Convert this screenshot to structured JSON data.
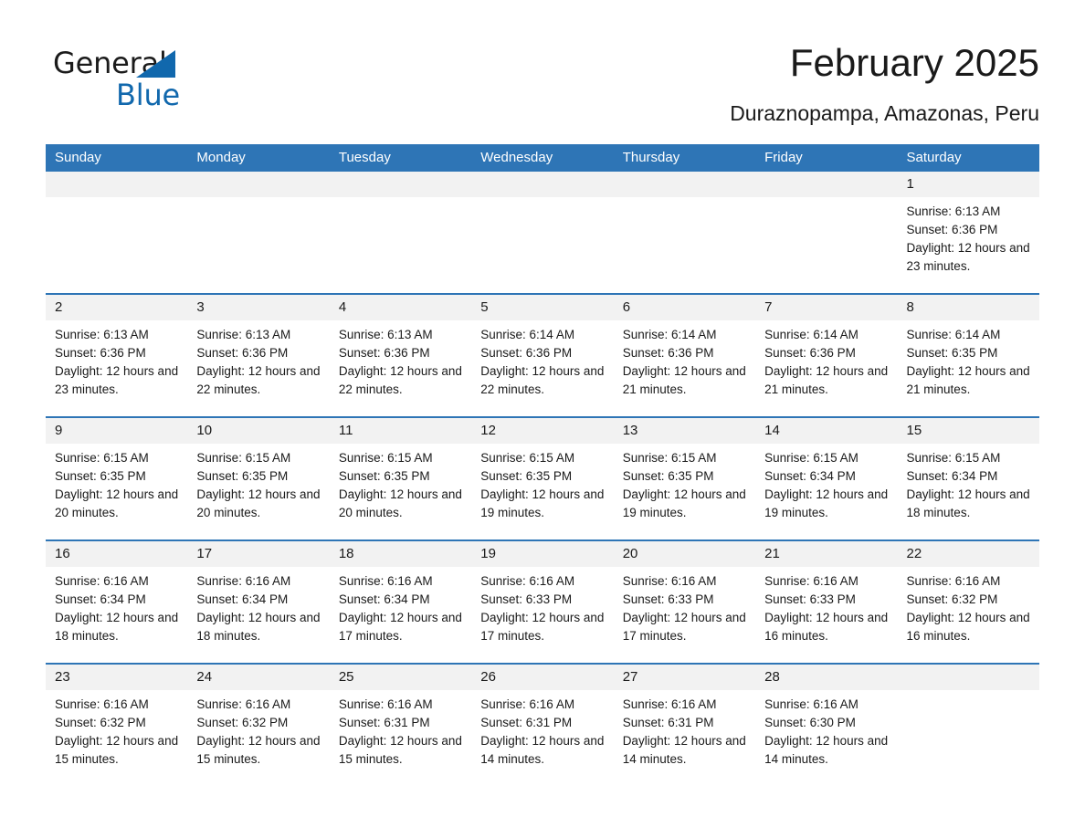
{
  "brand": {
    "name_part1": "General",
    "name_part2": "Blue",
    "accent_color": "#1168ad"
  },
  "header": {
    "title": "February 2025",
    "subtitle": "Duraznopampa, Amazonas, Peru"
  },
  "theme": {
    "header_blue": "#2e75b6",
    "daynumber_band": "#f2f2f2"
  },
  "weekdays": [
    "Sunday",
    "Monday",
    "Tuesday",
    "Wednesday",
    "Thursday",
    "Friday",
    "Saturday"
  ],
  "weeks": [
    [
      {
        "day": "",
        "sunrise": "",
        "sunset": "",
        "daylight": "",
        "empty": true
      },
      {
        "day": "",
        "sunrise": "",
        "sunset": "",
        "daylight": "",
        "empty": true
      },
      {
        "day": "",
        "sunrise": "",
        "sunset": "",
        "daylight": "",
        "empty": true
      },
      {
        "day": "",
        "sunrise": "",
        "sunset": "",
        "daylight": "",
        "empty": true
      },
      {
        "day": "",
        "sunrise": "",
        "sunset": "",
        "daylight": "",
        "empty": true
      },
      {
        "day": "",
        "sunrise": "",
        "sunset": "",
        "daylight": "",
        "empty": true
      },
      {
        "day": "1",
        "sunrise": "Sunrise: 6:13 AM",
        "sunset": "Sunset: 6:36 PM",
        "daylight": "Daylight: 12 hours and 23 minutes.",
        "empty": false
      }
    ],
    [
      {
        "day": "2",
        "sunrise": "Sunrise: 6:13 AM",
        "sunset": "Sunset: 6:36 PM",
        "daylight": "Daylight: 12 hours and 23 minutes.",
        "empty": false
      },
      {
        "day": "3",
        "sunrise": "Sunrise: 6:13 AM",
        "sunset": "Sunset: 6:36 PM",
        "daylight": "Daylight: 12 hours and 22 minutes.",
        "empty": false
      },
      {
        "day": "4",
        "sunrise": "Sunrise: 6:13 AM",
        "sunset": "Sunset: 6:36 PM",
        "daylight": "Daylight: 12 hours and 22 minutes.",
        "empty": false
      },
      {
        "day": "5",
        "sunrise": "Sunrise: 6:14 AM",
        "sunset": "Sunset: 6:36 PM",
        "daylight": "Daylight: 12 hours and 22 minutes.",
        "empty": false
      },
      {
        "day": "6",
        "sunrise": "Sunrise: 6:14 AM",
        "sunset": "Sunset: 6:36 PM",
        "daylight": "Daylight: 12 hours and 21 minutes.",
        "empty": false
      },
      {
        "day": "7",
        "sunrise": "Sunrise: 6:14 AM",
        "sunset": "Sunset: 6:36 PM",
        "daylight": "Daylight: 12 hours and 21 minutes.",
        "empty": false
      },
      {
        "day": "8",
        "sunrise": "Sunrise: 6:14 AM",
        "sunset": "Sunset: 6:35 PM",
        "daylight": "Daylight: 12 hours and 21 minutes.",
        "empty": false
      }
    ],
    [
      {
        "day": "9",
        "sunrise": "Sunrise: 6:15 AM",
        "sunset": "Sunset: 6:35 PM",
        "daylight": "Daylight: 12 hours and 20 minutes.",
        "empty": false
      },
      {
        "day": "10",
        "sunrise": "Sunrise: 6:15 AM",
        "sunset": "Sunset: 6:35 PM",
        "daylight": "Daylight: 12 hours and 20 minutes.",
        "empty": false
      },
      {
        "day": "11",
        "sunrise": "Sunrise: 6:15 AM",
        "sunset": "Sunset: 6:35 PM",
        "daylight": "Daylight: 12 hours and 20 minutes.",
        "empty": false
      },
      {
        "day": "12",
        "sunrise": "Sunrise: 6:15 AM",
        "sunset": "Sunset: 6:35 PM",
        "daylight": "Daylight: 12 hours and 19 minutes.",
        "empty": false
      },
      {
        "day": "13",
        "sunrise": "Sunrise: 6:15 AM",
        "sunset": "Sunset: 6:35 PM",
        "daylight": "Daylight: 12 hours and 19 minutes.",
        "empty": false
      },
      {
        "day": "14",
        "sunrise": "Sunrise: 6:15 AM",
        "sunset": "Sunset: 6:34 PM",
        "daylight": "Daylight: 12 hours and 19 minutes.",
        "empty": false
      },
      {
        "day": "15",
        "sunrise": "Sunrise: 6:15 AM",
        "sunset": "Sunset: 6:34 PM",
        "daylight": "Daylight: 12 hours and 18 minutes.",
        "empty": false
      }
    ],
    [
      {
        "day": "16",
        "sunrise": "Sunrise: 6:16 AM",
        "sunset": "Sunset: 6:34 PM",
        "daylight": "Daylight: 12 hours and 18 minutes.",
        "empty": false
      },
      {
        "day": "17",
        "sunrise": "Sunrise: 6:16 AM",
        "sunset": "Sunset: 6:34 PM",
        "daylight": "Daylight: 12 hours and 18 minutes.",
        "empty": false
      },
      {
        "day": "18",
        "sunrise": "Sunrise: 6:16 AM",
        "sunset": "Sunset: 6:34 PM",
        "daylight": "Daylight: 12 hours and 17 minutes.",
        "empty": false
      },
      {
        "day": "19",
        "sunrise": "Sunrise: 6:16 AM",
        "sunset": "Sunset: 6:33 PM",
        "daylight": "Daylight: 12 hours and 17 minutes.",
        "empty": false
      },
      {
        "day": "20",
        "sunrise": "Sunrise: 6:16 AM",
        "sunset": "Sunset: 6:33 PM",
        "daylight": "Daylight: 12 hours and 17 minutes.",
        "empty": false
      },
      {
        "day": "21",
        "sunrise": "Sunrise: 6:16 AM",
        "sunset": "Sunset: 6:33 PM",
        "daylight": "Daylight: 12 hours and 16 minutes.",
        "empty": false
      },
      {
        "day": "22",
        "sunrise": "Sunrise: 6:16 AM",
        "sunset": "Sunset: 6:32 PM",
        "daylight": "Daylight: 12 hours and 16 minutes.",
        "empty": false
      }
    ],
    [
      {
        "day": "23",
        "sunrise": "Sunrise: 6:16 AM",
        "sunset": "Sunset: 6:32 PM",
        "daylight": "Daylight: 12 hours and 15 minutes.",
        "empty": false
      },
      {
        "day": "24",
        "sunrise": "Sunrise: 6:16 AM",
        "sunset": "Sunset: 6:32 PM",
        "daylight": "Daylight: 12 hours and 15 minutes.",
        "empty": false
      },
      {
        "day": "25",
        "sunrise": "Sunrise: 6:16 AM",
        "sunset": "Sunset: 6:31 PM",
        "daylight": "Daylight: 12 hours and 15 minutes.",
        "empty": false
      },
      {
        "day": "26",
        "sunrise": "Sunrise: 6:16 AM",
        "sunset": "Sunset: 6:31 PM",
        "daylight": "Daylight: 12 hours and 14 minutes.",
        "empty": false
      },
      {
        "day": "27",
        "sunrise": "Sunrise: 6:16 AM",
        "sunset": "Sunset: 6:31 PM",
        "daylight": "Daylight: 12 hours and 14 minutes.",
        "empty": false
      },
      {
        "day": "28",
        "sunrise": "Sunrise: 6:16 AM",
        "sunset": "Sunset: 6:30 PM",
        "daylight": "Daylight: 12 hours and 14 minutes.",
        "empty": false
      },
      {
        "day": "",
        "sunrise": "",
        "sunset": "",
        "daylight": "",
        "empty": true
      }
    ]
  ]
}
